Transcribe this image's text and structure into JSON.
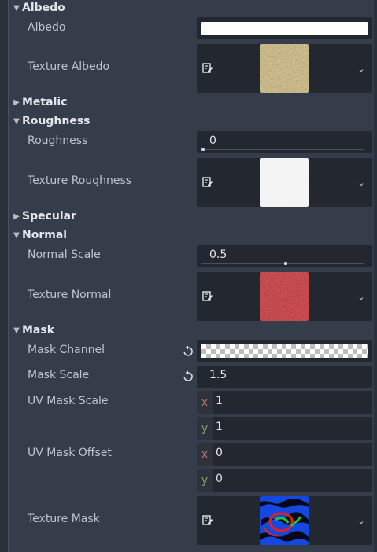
{
  "sections": {
    "albedo": "Albedo",
    "metalic": "Metalic",
    "roughness": "Roughness",
    "specular": "Specular",
    "normal": "Normal",
    "mask": "Mask"
  },
  "albedo": {
    "color_label": "Albedo",
    "color_value": "#ffffff",
    "texture_label": "Texture Albedo"
  },
  "roughness": {
    "value_label": "Roughness",
    "value": "0",
    "slider_fraction": 0,
    "texture_label": "Texture Roughness"
  },
  "normal": {
    "scale_label": "Normal Scale",
    "scale_value": "0.5",
    "slider_fraction": 0.5,
    "texture_label": "Texture Normal"
  },
  "mask": {
    "channel_label": "Mask Channel",
    "scale_label": "Mask Scale",
    "scale_value": "1.5",
    "uv_scale_label": "UV Mask Scale",
    "uv_scale_x": "1",
    "uv_scale_y": "1",
    "uv_offset_label": "UV Mask Offset",
    "uv_offset_x": "0",
    "uv_offset_y": "0",
    "texture_label": "Texture Mask"
  },
  "axes": {
    "x": "x",
    "y": "y"
  },
  "icons": {
    "section_open": "chevron-down-icon",
    "section_closed": "chevron-right-icon",
    "edit": "edit-texture-icon",
    "reset": "reset-icon",
    "dropdown": "chevron-down-icon"
  },
  "colors": {
    "background": "#363d4a",
    "field": "#232830",
    "axis_x": "#c0715c",
    "axis_y": "#7aa56a"
  }
}
